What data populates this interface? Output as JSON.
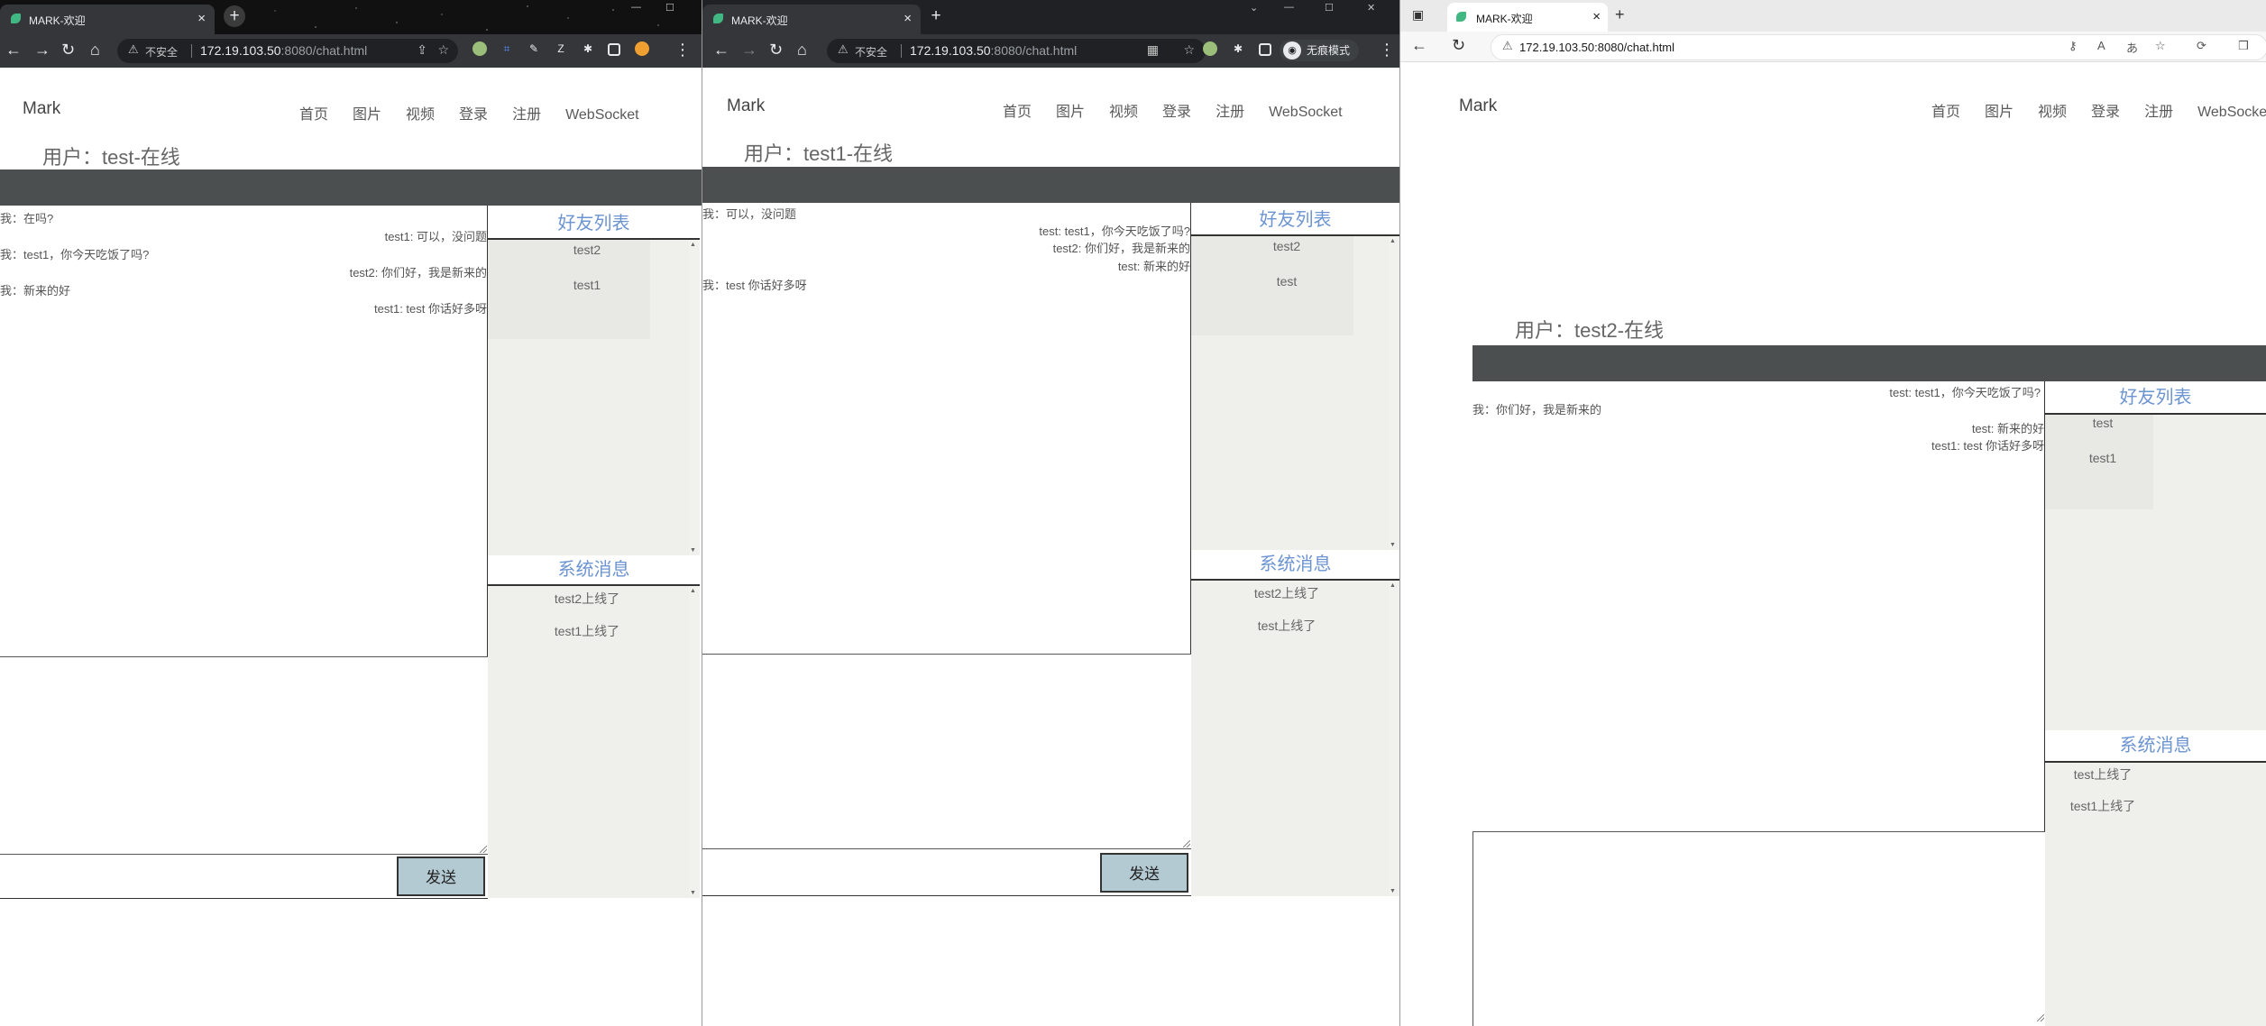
{
  "browser": {
    "tab_title": "MARK-欢迎",
    "insecure": "不安全",
    "url_host": "172.19.103.50",
    "url_path": ":8080/chat.html",
    "incognito_label": "无痕模式"
  },
  "site": {
    "brand": "Mark",
    "nav": [
      "首页",
      "图片",
      "视频",
      "登录",
      "注册",
      "WebSocket"
    ],
    "friends_heading": "好友列表",
    "system_heading": "系统消息",
    "send_label": "发送"
  },
  "windows": [
    {
      "user_line": "用户：test-在线",
      "messages_left": [
        "我：在吗?",
        "我：test1，你今天吃饭了吗?",
        "我：新来的好"
      ],
      "messages_right": [
        "test1: 可以，没问题",
        "test2: 你们好，我是新来的",
        "test1: test 你话好多呀"
      ],
      "friends": [
        "test2",
        "test1"
      ],
      "system": [
        "test2上线了",
        "test1上线了"
      ]
    },
    {
      "user_line": "用户：test1-在线",
      "messages_left": [
        "我：可以，没问题",
        "我：test 你话好多呀"
      ],
      "messages_right": [
        "test: test1，你今天吃饭了吗?",
        "test2: 你们好，我是新来的",
        "test: 新来的好"
      ],
      "friends": [
        "test2",
        "test"
      ],
      "system": [
        "test2上线了",
        "test上线了"
      ]
    },
    {
      "user_line": "用户：test2-在线",
      "messages_left": [
        "我：你们好，我是新来的"
      ],
      "messages_right": [
        "test: test1，你今天吃饭了吗?",
        "test: 新来的好",
        "test1: test 你话好多呀"
      ],
      "friends": [
        "test",
        "test1"
      ],
      "system": [
        "test上线了",
        "test1上线了"
      ]
    }
  ],
  "icons": {
    "back": "back-arrow-icon",
    "forward": "forward-arrow-icon",
    "reload": "reload-icon",
    "home": "home-icon",
    "warning": "warning-icon",
    "star": "star-icon",
    "share": "share-icon",
    "extensions": "puzzle-icon",
    "menu": "kebab-menu-icon"
  },
  "colors": {
    "brand_blue": "#6b94d1",
    "header_bar": "#4b4f4f",
    "send_button": "#b4cad3",
    "tab_favicon": "#41b883"
  }
}
